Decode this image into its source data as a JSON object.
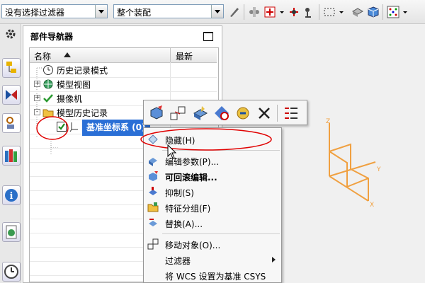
{
  "toolbar": {
    "filter_combo": "没有选择过滤器",
    "assembly_combo": "整个装配"
  },
  "navigator": {
    "title": "部件导航器",
    "columns": [
      "名称",
      "最新"
    ],
    "rows": [
      {
        "label": "历史记录模式",
        "icon": "clock-icon",
        "expander": ""
      },
      {
        "label": "模型视图",
        "icon": "model-view-icon",
        "expander": "+"
      },
      {
        "label": "摄像机",
        "icon": "camera-check-icon",
        "expander": "+"
      },
      {
        "label": "模型历史记录",
        "icon": "folder-icon",
        "expander": "-"
      },
      {
        "label": "基准坐标系 (0)",
        "icon": "datum-csys-icon",
        "expander": "",
        "selected": true
      }
    ]
  },
  "context_menu": {
    "items": [
      {
        "label": "隐藏(H)",
        "icon": "hide-icon",
        "bold": false
      },
      {
        "label": "编辑参数(P)...",
        "icon": "edit-params-icon",
        "bold": false
      },
      {
        "label": "可回滚编辑...",
        "icon": "rollback-edit-icon",
        "bold": true
      },
      {
        "label": "抑制(S)",
        "icon": "suppress-icon",
        "bold": false
      },
      {
        "label": "特征分组(F)",
        "icon": "feature-group-icon",
        "bold": false
      },
      {
        "label": "替换(A)...",
        "icon": "replace-icon",
        "bold": false
      },
      {
        "label": "移动对象(O)...",
        "icon": "move-object-icon",
        "bold": false
      },
      {
        "label": "过滤器",
        "icon": "",
        "bold": false,
        "submenu": true
      },
      {
        "label": "将 WCS 设置为基准 CSYS",
        "icon": "",
        "bold": false
      }
    ]
  },
  "viewport": {
    "axis_color": "#f0a040",
    "axes": [
      "Z",
      "Y",
      "X"
    ]
  },
  "annotation_color": "#e00000",
  "selection_color": "#2a6fd6"
}
